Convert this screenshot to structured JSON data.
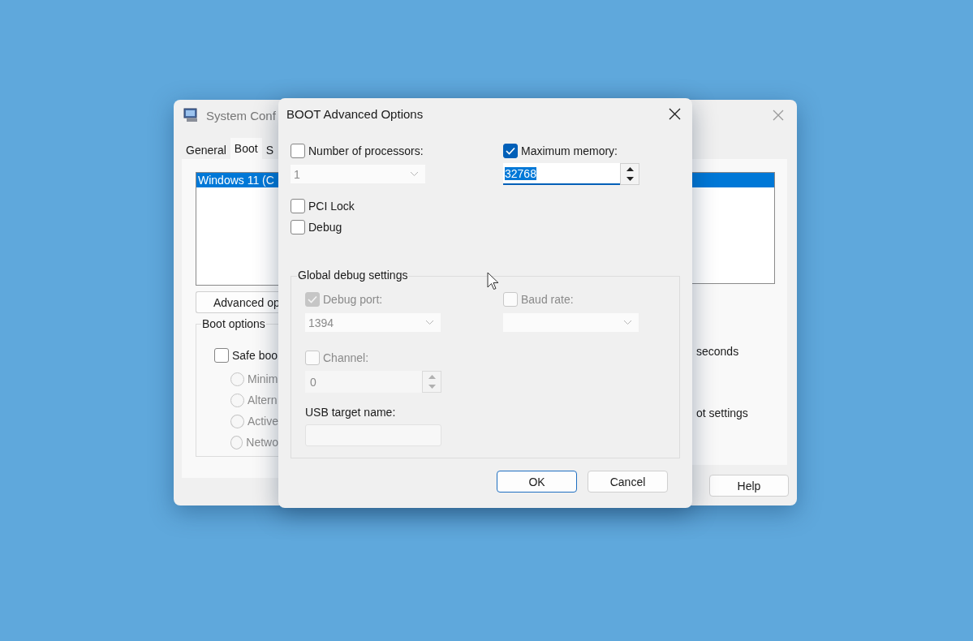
{
  "background_window": {
    "title": "System Conf",
    "tabs": [
      {
        "label": "General",
        "selected": false
      },
      {
        "label": "Boot",
        "selected": true
      },
      {
        "label": "S",
        "selected": false
      }
    ],
    "boot_list": [
      {
        "label": "Windows 11 (C",
        "selected": true
      }
    ],
    "advanced_button": "Advanced op",
    "boot_options": {
      "title": "Boot options",
      "safe_boot": {
        "label": "Safe boo",
        "checked": false
      },
      "radios": [
        {
          "label": "Minim",
          "selected": false,
          "disabled": true
        },
        {
          "label": "Altern",
          "selected": false,
          "disabled": true
        },
        {
          "label": "Active",
          "selected": false,
          "disabled": true
        },
        {
          "label": "Netwo",
          "selected": false,
          "disabled": true
        }
      ]
    },
    "right_texts": [
      "seconds",
      "ot settings"
    ],
    "buttons": [
      "Help"
    ]
  },
  "dialog": {
    "title": "BOOT Advanced Options",
    "number_of_processors": {
      "label": "Number of processors:",
      "checked": false,
      "value": "1",
      "disabled": true
    },
    "maximum_memory": {
      "label": "Maximum memory:",
      "checked": true,
      "value": "32768",
      "value_selected": true
    },
    "pci_lock": {
      "label": "PCI Lock",
      "checked": false
    },
    "debug": {
      "label": "Debug",
      "checked": false
    },
    "global_debug": {
      "title": "Global debug settings",
      "debug_port": {
        "label": "Debug port:",
        "checked": true,
        "disabled": true,
        "value": "1394"
      },
      "baud_rate": {
        "label": "Baud rate:",
        "checked": false,
        "disabled": true
      },
      "channel": {
        "label": "Channel:",
        "checked": false,
        "disabled": true,
        "value": "0"
      },
      "usb_target_name": {
        "label": "USB target name:",
        "disabled": true
      }
    },
    "buttons": [
      {
        "label": "OK",
        "default": true
      },
      {
        "label": "Cancel",
        "default": false
      }
    ]
  }
}
